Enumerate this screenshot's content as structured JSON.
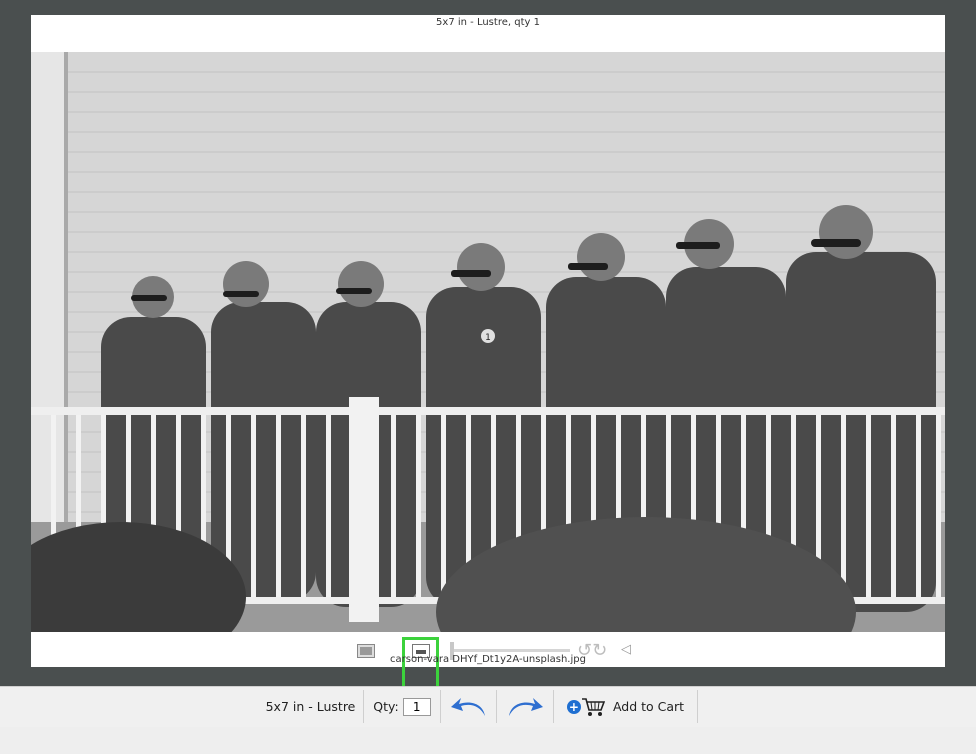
{
  "print": {
    "title": "5x7 in - Lustre, qty 1",
    "filename": "carson-vara DHYf_Dt1y2A-unsplash.jpg",
    "badge_number": "1"
  },
  "toolbar": {
    "product_label": "5x7 in - Lustre",
    "qty_label": "Qty:",
    "qty_value": "1",
    "add_to_cart_label": "Add to Cart"
  },
  "icons": {
    "crop_a": "crop-landscape-icon",
    "crop_b": "crop-fit-icon",
    "rotate_left": "rotate-left-icon",
    "rotate_right": "rotate-right-icon",
    "prev": "previous-arrow-icon",
    "undo": "undo-icon",
    "redo": "redo-icon",
    "add": "plus-circle-icon",
    "cart": "shopping-cart-icon"
  },
  "colors": {
    "background": "#4a4f4f",
    "highlight": "#3cd23c",
    "accent": "#1f6fd1"
  }
}
